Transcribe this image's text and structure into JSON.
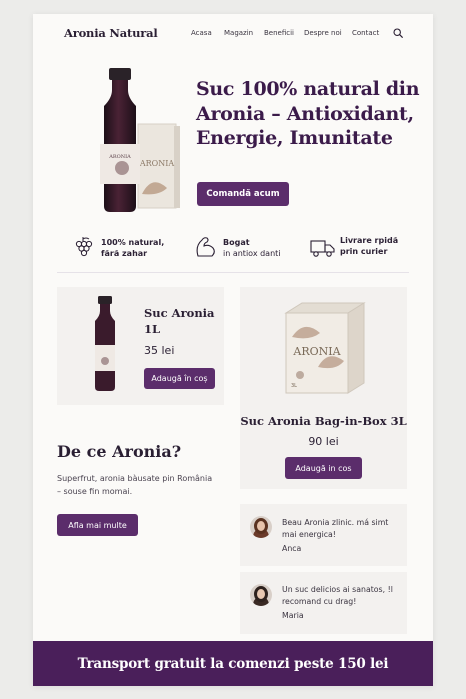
{
  "header": {
    "brand": "Aronia Natural",
    "nav": [
      "Acasa",
      "Magazin",
      "Beneficii",
      "Despre noi",
      "Contact"
    ],
    "search_icon": "search-icon"
  },
  "hero": {
    "title": "Suc 100% natural din Aronia – Antioxidant, Energie, Imunitate",
    "cta": "Comandă acum",
    "bottle_label": "ARONIA",
    "box_label": "ARONIA"
  },
  "features": [
    {
      "icon": "grapes-icon",
      "line1": "100% natural,",
      "line2": "fără zahar"
    },
    {
      "icon": "strength-icon",
      "line1": "Bogat",
      "line2": "in antiox danti"
    },
    {
      "icon": "truck-icon",
      "line1": "Livrare rpidă",
      "line2": "prin curier"
    }
  ],
  "products": [
    {
      "name": "Suc Aronia 1L",
      "price": "35 lei",
      "cta": "Adaugă în coș"
    },
    {
      "name": "Suc Aronia Bag-in-Box 3L",
      "price": "90 lei",
      "cta": "Adaugă in cos",
      "box_label": "ARONIA",
      "box_size": "3L"
    }
  ],
  "why": {
    "title": "De ce Aronia?",
    "text": "Superfrut, aronia bàusate pin România – souse fin momai.",
    "cta": "Afla mai multe"
  },
  "testimonials": [
    {
      "text": "Beau Aronia zlinic. má simt mai energica!",
      "author": "Anca"
    },
    {
      "text": "Un suc delicios ai sanatos, !l recomand cu drag!",
      "author": "Maria"
    }
  ],
  "banner": "Transport gratuit la comenzi peste 150 lei",
  "colors": {
    "accent": "#5b2d6b",
    "banner": "#4a1f5a",
    "text": "#2a1f33"
  }
}
